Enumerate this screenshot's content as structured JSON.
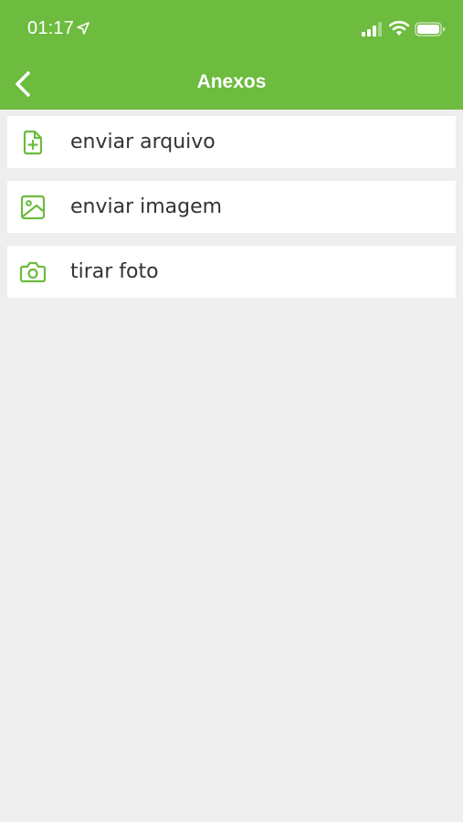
{
  "status_bar": {
    "time": "01:17",
    "icons": [
      "location-arrow-icon",
      "cellular-signal-icon",
      "wifi-icon",
      "battery-icon"
    ]
  },
  "nav": {
    "title": "Anexos",
    "back_icon": "chevron-left-icon"
  },
  "attachments": {
    "items": [
      {
        "label": "enviar arquivo",
        "icon": "file-plus-icon"
      },
      {
        "label": "enviar imagem",
        "icon": "image-icon"
      },
      {
        "label": "tirar foto",
        "icon": "camera-icon"
      }
    ]
  },
  "colors": {
    "brand_green": "#6dbb3f",
    "background": "#eeeeee",
    "item_background": "#ffffff",
    "item_text": "#333333"
  }
}
